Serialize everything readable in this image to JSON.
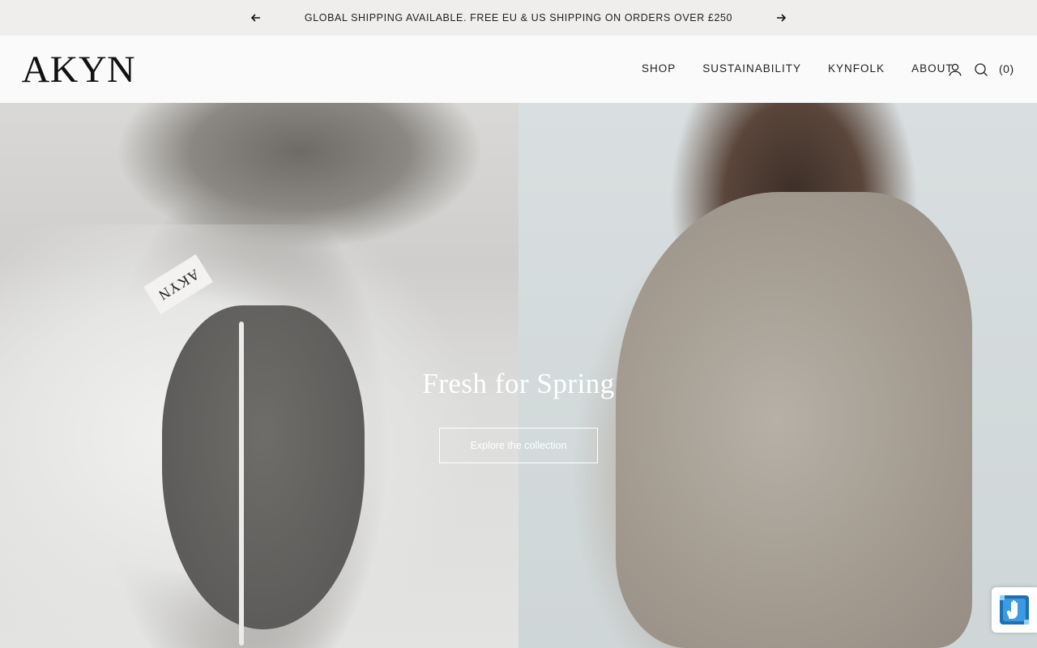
{
  "announcement": {
    "message": "GLOBAL SHIPPING AVAILABLE. FREE EU & US SHIPPING ON ORDERS OVER £250",
    "prev_icon": "arrow-left-icon",
    "next_icon": "arrow-right-icon"
  },
  "header": {
    "logo": "AKYN",
    "nav": [
      {
        "label": "SHOP"
      },
      {
        "label": "SUSTAINABILITY"
      },
      {
        "label": "KYNFOLK"
      },
      {
        "label": "ABOUT"
      }
    ],
    "account_icon": "user-icon",
    "search_icon": "search-icon",
    "cart_label": "(0)"
  },
  "hero": {
    "title": "Fresh for Spring",
    "cta_label": "Explore the collection",
    "garment_label_text": "AKYN"
  },
  "widget": {
    "icon": "accessibility-hand-icon",
    "accent_color": "#2a8fd6"
  }
}
